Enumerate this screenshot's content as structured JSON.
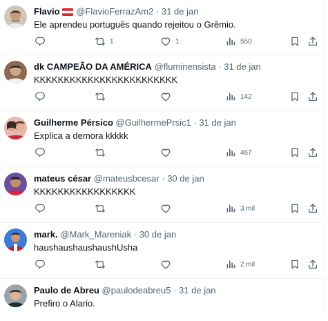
{
  "tweets": [
    {
      "name": "Flavio",
      "flag": "austria-flag-icon",
      "handle": "@FlavioFerrazAm2",
      "sep": "·",
      "date": "31 de jan",
      "text": "Ele aprendeu português quando rejeitou o Grêmio.",
      "retweets": "1",
      "likes": "1",
      "views": "550"
    },
    {
      "name": "dk CAMPEÃO DA AMÉRICA",
      "handle": "@fluminensista",
      "sep": "·",
      "date": "31 de jan",
      "text": "KKKKKKKKKKKKKKKKKKKKKKKK",
      "retweets": "",
      "likes": "",
      "views": "142"
    },
    {
      "name": "Guilherme Pérsico",
      "handle": "@GuilhermePrsic1",
      "sep": "·",
      "date": "31 de jan",
      "text": "Explica a demora kkkkk",
      "retweets": "",
      "likes": "",
      "views": "467"
    },
    {
      "name": "mateus césar",
      "handle": "@mateusbcesar",
      "sep": "·",
      "date": "30 de jan",
      "text": "KKKKKKKKKKKKKKKKK",
      "retweets": "",
      "likes": "",
      "views": "3 mil"
    },
    {
      "name": "mark.",
      "handle": "@Mark_Mareniak",
      "sep": "·",
      "date": "30 de jan",
      "text": "haushaushaushaushUsha",
      "retweets": "",
      "likes": "",
      "views": "2 mil"
    },
    {
      "name": "Paulo de Abreu",
      "handle": "@paulodeabreu5",
      "sep": "·",
      "date": "31 de jan",
      "text": "Prefiro o Alario."
    }
  ],
  "icons": {
    "reply": "reply-icon",
    "retweet": "retweet-icon",
    "like": "heart-icon",
    "views": "views-icon",
    "bookmark": "bookmark-icon",
    "share": "share-icon"
  },
  "colors": {
    "text": "#0f1419",
    "secondary": "#536471",
    "border": "#eff3f4",
    "flag_red": "#e0242e"
  }
}
